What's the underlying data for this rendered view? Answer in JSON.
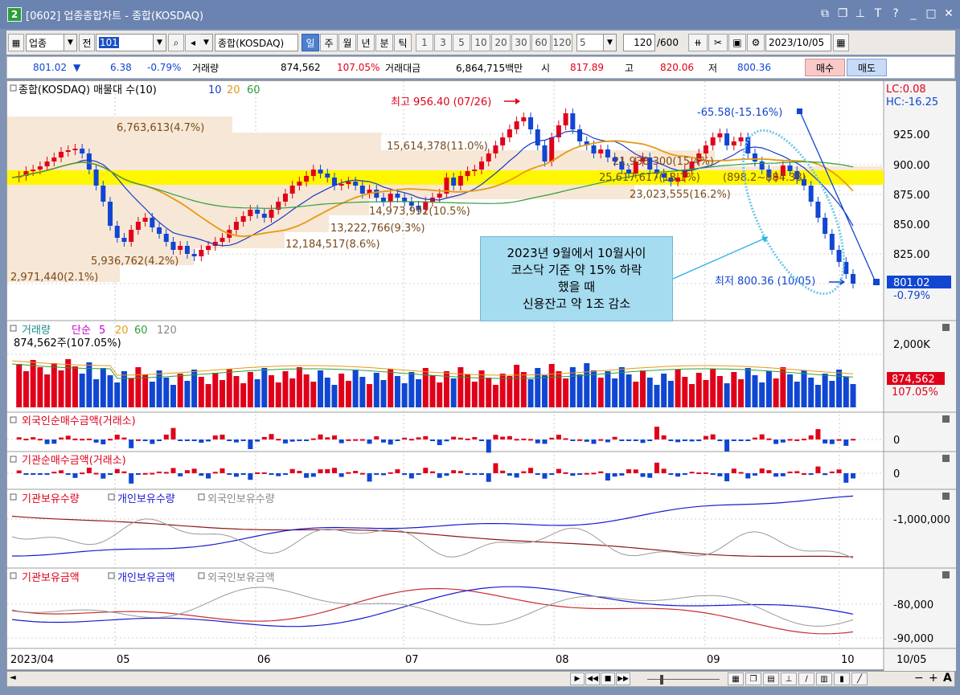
{
  "window": {
    "number": "2",
    "title": "[0602] 업종종합차트 - 종합(KOSDAQ)"
  },
  "toolbar": {
    "category": "업종",
    "prev_label": "전",
    "code": "101",
    "search_icon": "search-icon",
    "sound_icon": "speaker-icon",
    "market_name": "종합(KOSDAQ)",
    "periods": [
      "일",
      "주",
      "월",
      "년",
      "분",
      "틱"
    ],
    "active_period": "일",
    "intervals": [
      "1",
      "3",
      "5",
      "10",
      "20",
      "30",
      "60",
      "120"
    ],
    "interval_value": "5",
    "count": "120",
    "total": "/600",
    "date": "2023/10/05"
  },
  "quote": {
    "price": "801.02",
    "arrow": "▼",
    "change": "6.38",
    "rate": "-0.79%",
    "volume_label": "거래량",
    "volume": "874,562",
    "volume_rate": "107.05%",
    "amount_label": "거래대금",
    "amount": "6,864,715백만",
    "open_label": "시",
    "open": "817.89",
    "high_label": "고",
    "high": "820.06",
    "low_label": "저",
    "low": "800.36",
    "buy": "매수",
    "sell": "매도"
  },
  "colors": {
    "up": "#e0001a",
    "down": "#1046d1",
    "ma10": "#1a3cc8",
    "ma20": "#e69a12",
    "ma60": "#2e9e3e",
    "highlight": "#fff700",
    "volband": "#f7e7d6"
  },
  "price_panel": {
    "title": "종합(KOSDAQ) 매물대 수(10)",
    "ma_labels": [
      "10",
      "20",
      "60"
    ],
    "lc": "LC:0.08",
    "hc": "HC:-16.25",
    "high_note": "최고 956.40 (07/26)",
    "low_note": "최저 800.36 (10/05)",
    "drop_note": "-65.58(-15.16%)",
    "cur_price": "801.02",
    "cur_rate": "-0.79%",
    "y_ticks": [
      "925.00",
      "900.00",
      "875.00",
      "850.00",
      "825.00",
      "800.00"
    ],
    "bands": [
      "2,971,440(2.1%)",
      "5,936,762(4.2%)",
      "12,184,517(8.6%)",
      "13,222,766(9.3%)",
      "14,973,992(10.5%)",
      "25,617,617(18.1%)",
      "21,938,300(15.4%)",
      "15,614,378(11.0%)",
      "23,023,555(16.2%)",
      "6,763,613(4.7%)"
    ],
    "range_label": "(898.2~884.38)"
  },
  "volume_panel": {
    "title": "거래량",
    "ma_title": "단순",
    "ma_labels": [
      "5",
      "20",
      "60",
      "120"
    ],
    "value_label": "874,562주(107.05%)",
    "y_ticks": [
      "2,000K",
      "0"
    ],
    "cur_value": "874,562",
    "cur_rate": "107.05%"
  },
  "foreign_panel": {
    "title": "외국인순매수금액(거래소)",
    "y_tick": "0"
  },
  "inst_panel": {
    "title": "기관순매수금액(거래소)",
    "y_tick": "0"
  },
  "holding_qty_panel": {
    "labels": [
      "기관보유수량",
      "개인보유수량",
      "외국인보유수량"
    ],
    "y_tick": "-1,000,000"
  },
  "holding_amt_panel": {
    "labels": [
      "기관보유금액",
      "개인보유금액",
      "외국인보유금액"
    ],
    "y_ticks": [
      "-80,000",
      "-90,000"
    ]
  },
  "x_axis": {
    "labels": [
      "2023/04",
      "05",
      "06",
      "07",
      "08",
      "09",
      "10"
    ],
    "end": "10/05"
  },
  "annotation": {
    "lines": [
      "2023년 9월에서 10월사이",
      "코스닥 기준 약 15% 하락",
      "했을 때",
      "신용잔고 약 1조 감소"
    ]
  },
  "chart_data": {
    "type": "candlestick",
    "period": "daily",
    "ylim": [
      790,
      965
    ],
    "high": 956.4,
    "high_date": "07/26",
    "low": 800.36,
    "low_date": "10/05",
    "last_close": 801.02,
    "last_change": -6.38,
    "last_rate": -0.79
  },
  "statusbar": {
    "zoom_minus": "−",
    "zoom_plus": "+",
    "font_a": "A"
  }
}
